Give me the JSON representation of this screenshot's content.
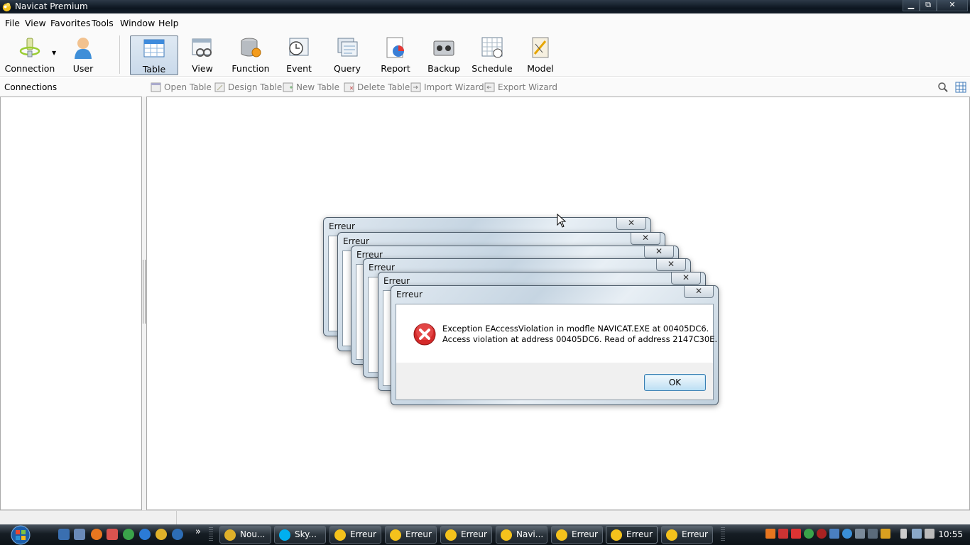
{
  "window": {
    "title": "Navicat Premium",
    "buttons": {
      "minimize": "▁",
      "maximize": "⧉",
      "close": "✕"
    }
  },
  "menu": [
    "File",
    "View",
    "Favorites",
    "Tools",
    "Window",
    "Help"
  ],
  "toolbar": {
    "connection": "Connection",
    "user": "User",
    "table": "Table",
    "view": "View",
    "function": "Function",
    "event": "Event",
    "query": "Query",
    "report": "Report",
    "backup": "Backup",
    "schedule": "Schedule",
    "model": "Model"
  },
  "subtoolbar": {
    "connections_label": "Connections",
    "open_table": "Open Table",
    "design_table": "Design Table",
    "new_table": "New Table",
    "delete_table": "Delete Table",
    "import_wizard": "Import Wizard",
    "export_wizard": "Export Wizard"
  },
  "dialogs": {
    "title": "Erreur",
    "close_glyph": "✕",
    "message_line1": "Exception EAccessViolation in modfle NAVICAT.EXE at 00405DC6.",
    "message_line2": "Access violation at address 00405DC6. Read of address 2147C30E.",
    "ok_label": "OK"
  },
  "taskbar": {
    "buttons": [
      "Nou...",
      "Sky...",
      "Erreur",
      "Erreur",
      "Erreur",
      "Navi...",
      "Erreur",
      "Erreur",
      "Erreur"
    ],
    "more_glyph": "»",
    "clock": "10:55"
  },
  "colors": {
    "error_red": "#d42a2a",
    "selected_tool": "#c9d9ea",
    "taskbar": "#161d24"
  }
}
